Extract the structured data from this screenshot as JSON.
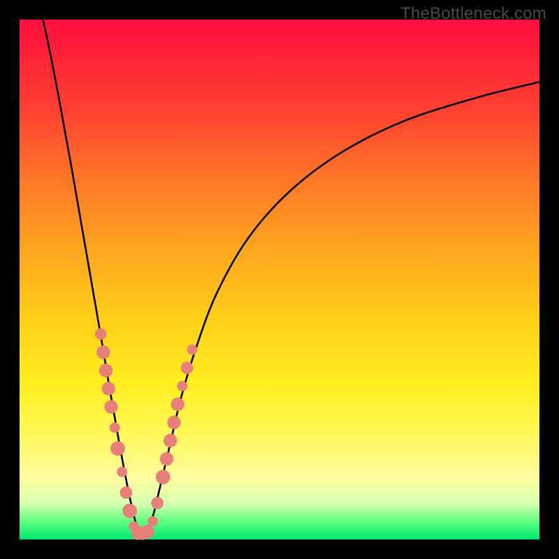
{
  "watermark": "TheBottleneck.com",
  "colors": {
    "frame": "#000000",
    "curve": "#000000",
    "bead": "#e77f7a"
  },
  "chart_data": {
    "type": "line",
    "title": "",
    "xlabel": "",
    "ylabel": "",
    "xlim": [
      0,
      100
    ],
    "ylim": [
      0,
      100
    ],
    "grid": false,
    "note": "Axes are unlabeled; x and y read as percent of plot width/height. y=0 at bottom. Curve is a V-shaped bottleneck profile reaching ~0 (green) near x≈23 and rising toward red at both extremes. Values estimated from pixel positions.",
    "series": [
      {
        "name": "bottleneck-curve",
        "x": [
          4.5,
          6,
          8,
          10,
          12,
          14,
          16,
          17.5,
          19,
          20.5,
          22,
          23,
          24,
          25.5,
          27,
          29,
          31,
          34,
          38,
          44,
          52,
          62,
          74,
          88,
          100
        ],
        "y": [
          100,
          93,
          82.5,
          71.5,
          60,
          48.5,
          37,
          28,
          19.5,
          11.5,
          4.5,
          1.5,
          1.5,
          4,
          10,
          18.5,
          27,
          37,
          47.5,
          58,
          67,
          74.5,
          80.5,
          85,
          88
        ]
      }
    ],
    "markers": {
      "name": "highlight-beads",
      "note": "Salmon-colored dots/capsules clustered near the bottom of the V, on both arms.",
      "points": [
        {
          "x": 15.6,
          "y": 39.5,
          "r": 1.1
        },
        {
          "x": 16.1,
          "y": 36.0,
          "r": 1.3
        },
        {
          "x": 16.6,
          "y": 32.5,
          "r": 1.3
        },
        {
          "x": 17.1,
          "y": 29.0,
          "r": 1.3
        },
        {
          "x": 17.6,
          "y": 25.5,
          "r": 1.3
        },
        {
          "x": 18.3,
          "y": 21.5,
          "r": 1.0
        },
        {
          "x": 18.9,
          "y": 17.5,
          "r": 1.4
        },
        {
          "x": 19.7,
          "y": 13.0,
          "r": 1.0
        },
        {
          "x": 20.5,
          "y": 9.0,
          "r": 1.2
        },
        {
          "x": 21.2,
          "y": 5.5,
          "r": 1.4
        },
        {
          "x": 22.0,
          "y": 2.5,
          "r": 1.0
        },
        {
          "x": 22.8,
          "y": 1.2,
          "r": 1.3
        },
        {
          "x": 23.7,
          "y": 1.2,
          "r": 1.3
        },
        {
          "x": 24.6,
          "y": 1.5,
          "r": 1.3
        },
        {
          "x": 25.6,
          "y": 3.5,
          "r": 1.0
        },
        {
          "x": 26.5,
          "y": 7.0,
          "r": 1.2
        },
        {
          "x": 27.6,
          "y": 12.0,
          "r": 1.4
        },
        {
          "x": 28.3,
          "y": 15.5,
          "r": 1.3
        },
        {
          "x": 29.0,
          "y": 19.0,
          "r": 1.3
        },
        {
          "x": 29.7,
          "y": 22.5,
          "r": 1.3
        },
        {
          "x": 30.4,
          "y": 26.0,
          "r": 1.3
        },
        {
          "x": 31.3,
          "y": 29.5,
          "r": 1.0
        },
        {
          "x": 32.2,
          "y": 33.0,
          "r": 1.2
        },
        {
          "x": 33.2,
          "y": 36.5,
          "r": 1.0
        }
      ]
    }
  }
}
